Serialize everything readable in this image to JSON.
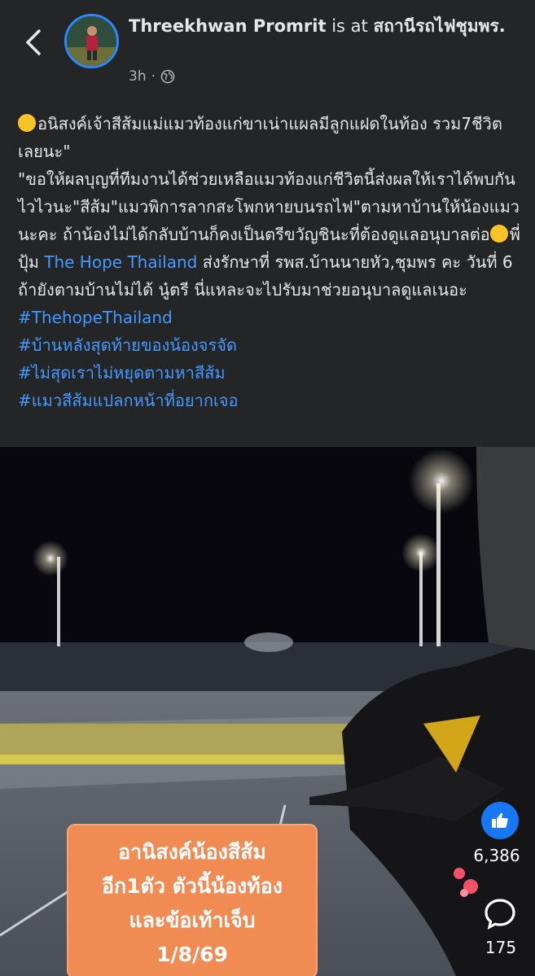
{
  "header": {
    "author_name": "Threekhwan Promrit",
    "is_at": "is at",
    "location": "สถานีรถไฟชุมพร.",
    "time": "3h"
  },
  "post": {
    "lines": [
      "อนิสงค์เจ้าสีส้มแม่แมวท้องแก่ขาเน่าแผลมีลูกแฝดในท้อง รวม7ชีวิตเลยนะ\"",
      "\"ขอให้ผลบุญที่ทีมงานได้ช่วยเหลือแมวท้องแก่ชีวิตนี้ส่งผลให้เราได้พบกันไวไวนะ\"สีส้ม\"แมวพิการลากสะโพกหายบนรถไฟ\"ตามหาบ้านให้น้องแมวนะคะ ถ้าน้องไม่ได้กลับบ้านก็คงเป็นตรีขวัญชินะที่ต้องดูแลอนุบาลต่อ",
      "พี่ปุ้ม",
      "The Hope Thailand",
      "ส่งรักษาที่ รพส.บ้านนายหัว,ชุมพร คะ วันที่ 6 ถ้ายังตามบ้านไม่ได้ นู๋ตรี นี่แหละจะไปรับมาช่วยอนุบาลดูแลเนอะ"
    ],
    "hashtags": [
      "#ThehopeThailand",
      "#บ้านหลังสุดท้ายของน้องจรจัด",
      "#ไม่สุดเราไม่หยุดตามหาสีส้ม",
      "#แมวสีส้มแปลกหน้าที่อยากเจอ"
    ]
  },
  "video": {
    "overlay_lines": [
      "อานิสงค์น้องสีส้ม",
      "อีก1ตัว ตัวนี้น้องท้อง",
      "และข้อเท้าเจ็บ",
      "1/8/69"
    ],
    "like_count": "6,386",
    "comment_count": "175"
  },
  "colors": {
    "link": "#4599ff",
    "overlay": "#f08b54",
    "like": "#1877f2"
  }
}
